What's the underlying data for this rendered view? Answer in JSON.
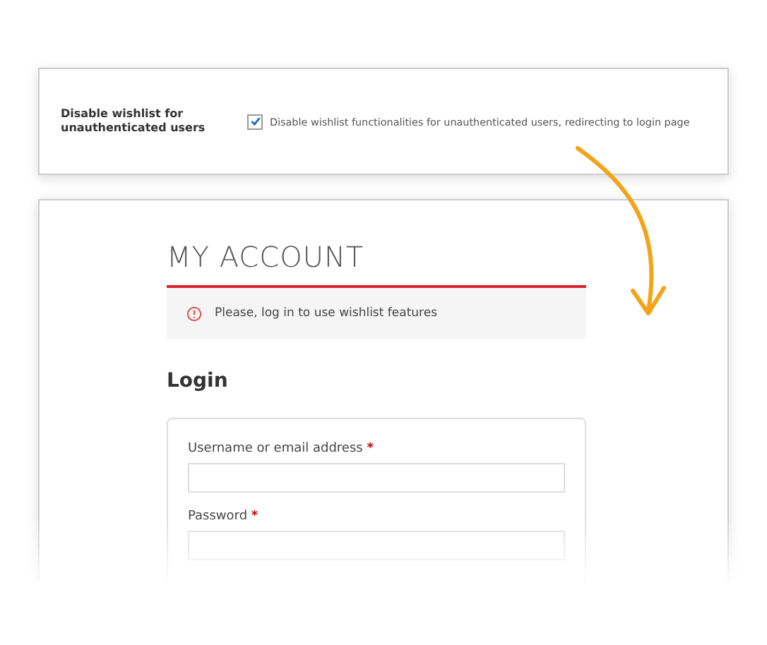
{
  "settings": {
    "label": "Disable wishlist for unauthenticated users",
    "option": {
      "checked": true,
      "text": "Disable wishlist functionalities for unauthenticated users, redirecting to login page"
    }
  },
  "account": {
    "title": "MY ACCOUNT",
    "notice": "Please, log in to use wishlist features",
    "heading": "Login",
    "fields": [
      {
        "label": "Username or email address",
        "required_mark": "*"
      },
      {
        "label": "Password",
        "required_mark": "*"
      }
    ]
  }
}
